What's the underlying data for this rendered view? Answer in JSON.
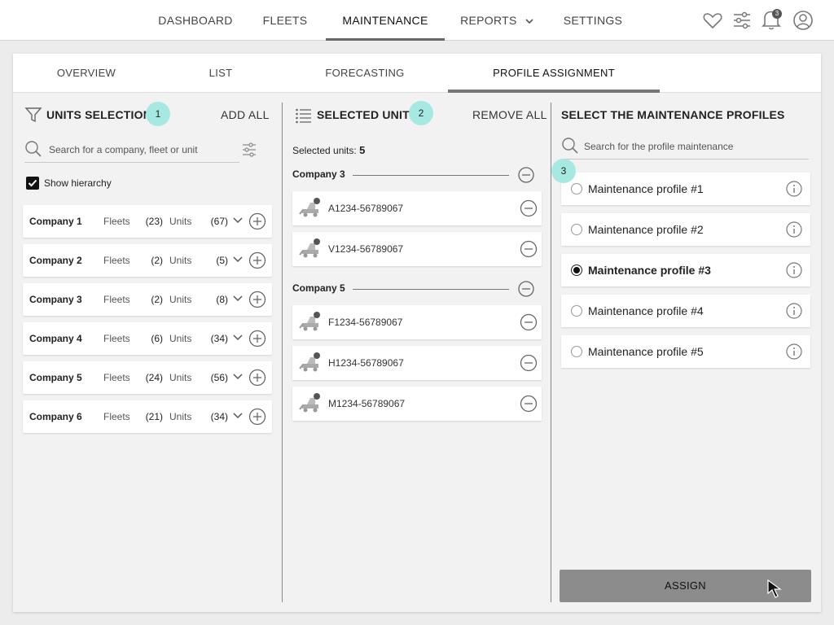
{
  "nav": {
    "items": [
      {
        "label": "DASHBOARD"
      },
      {
        "label": "FLEETS"
      },
      {
        "label": "MAINTENANCE"
      },
      {
        "label": "REPORTS"
      },
      {
        "label": "SETTINGS"
      }
    ],
    "active": "MAINTENANCE",
    "notification_count": "3",
    "icons": [
      "heart-icon",
      "sliders-icon",
      "bell-icon",
      "user-icon"
    ]
  },
  "subtabs": {
    "items": [
      {
        "label": "OVERVIEW"
      },
      {
        "label": "LIST"
      },
      {
        "label": "FORECASTING"
      },
      {
        "label": "PROFILE ASSIGNMENT"
      }
    ],
    "active": "PROFILE ASSIGNMENT"
  },
  "units_selection": {
    "title": "UNITS SELECTION",
    "step": "1",
    "add_all": "ADD ALL",
    "search_placeholder": "Search for a company, fleet or unit",
    "show_hierarchy": "Show hierarchy",
    "fleets_label": "Fleets",
    "units_label": "Units",
    "companies": [
      {
        "name": "Company 1",
        "fleets": "(23)",
        "units": "(67)"
      },
      {
        "name": "Company 2",
        "fleets": "(2)",
        "units": "(5)"
      },
      {
        "name": "Company 3",
        "fleets": "(2)",
        "units": "(8)"
      },
      {
        "name": "Company 4",
        "fleets": "(6)",
        "units": "(34)"
      },
      {
        "name": "Company 5",
        "fleets": "(24)",
        "units": "(56)"
      },
      {
        "name": "Company 6",
        "fleets": "(21)",
        "units": "(34)"
      }
    ]
  },
  "selected_units": {
    "title": "SELECTED UNITS",
    "step": "2",
    "remove_all": "REMOVE ALL",
    "count_label": "Selected units:",
    "count": "5",
    "groups": [
      {
        "company": "Company 3",
        "units": [
          "A1234-56789067",
          "V1234-56789067"
        ]
      },
      {
        "company": "Company 5",
        "units": [
          "F1234-56789067",
          "H1234-56789067",
          "M1234-56789067"
        ]
      }
    ]
  },
  "profiles": {
    "title": "SELECT THE MAINTENANCE PROFILES",
    "step": "3",
    "search_placeholder": "Search for the profile maintenance",
    "items": [
      {
        "name": "Maintenance profile #1",
        "selected": false
      },
      {
        "name": "Maintenance profile #2",
        "selected": false
      },
      {
        "name": "Maintenance profile #3",
        "selected": true
      },
      {
        "name": "Maintenance profile #4",
        "selected": false
      },
      {
        "name": "Maintenance profile #5",
        "selected": false
      }
    ],
    "assign_label": "ASSIGN"
  },
  "colors": {
    "badge": "#a6e9e2",
    "assign_button": "#8c8c8c",
    "background": "#ececec"
  }
}
